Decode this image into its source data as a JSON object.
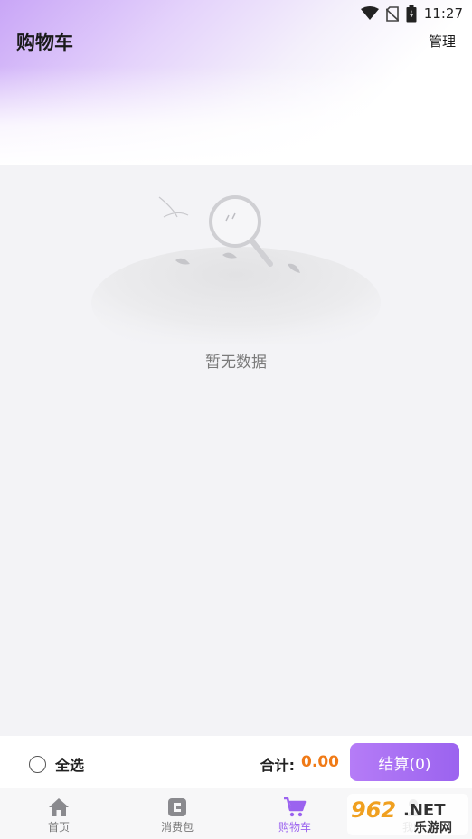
{
  "status_bar": {
    "time": "11:27"
  },
  "header": {
    "title": "购物车",
    "manage_label": "管理"
  },
  "empty_state": {
    "message": "暂无数据"
  },
  "checkout": {
    "select_all_label": "全选",
    "total_label": "合计:",
    "total_value": "0.00",
    "checkout_button_label": "结算(0)"
  },
  "tabbar": {
    "items": [
      {
        "label": "首页",
        "icon": "home-icon"
      },
      {
        "label": "消费包",
        "icon": "wallet-icon"
      },
      {
        "label": "购物车",
        "icon": "cart-icon",
        "active": true
      },
      {
        "label": "我的",
        "icon": "profile-icon"
      }
    ]
  },
  "watermark": {
    "text_top": "962.NET",
    "text_bottom": "乐游网"
  },
  "colors": {
    "accent": "#9b63ef",
    "price": "#f07a16"
  }
}
